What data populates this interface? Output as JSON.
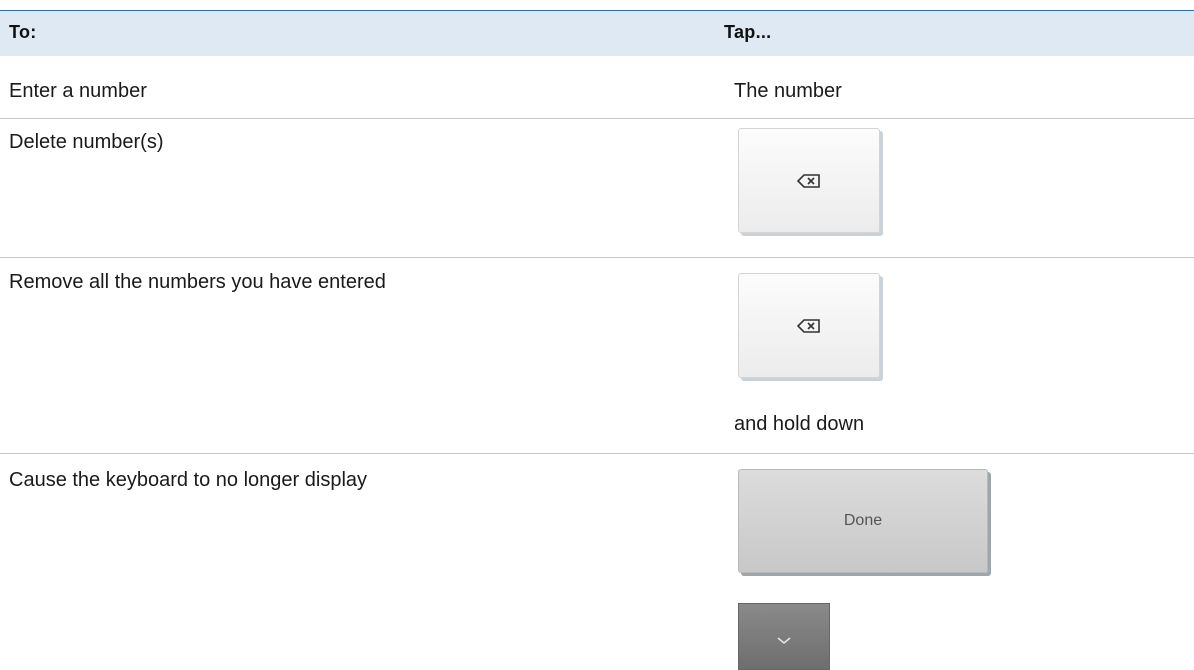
{
  "table": {
    "headers": {
      "col_action": "To:",
      "col_tap": "Tap..."
    },
    "rows": [
      {
        "action": "Enter a number",
        "tap": "The number"
      },
      {
        "action": "Delete number(s)",
        "key_icon": "backspace-icon"
      },
      {
        "action": "Remove all the numbers you have entered",
        "key_icon": "backspace-icon",
        "tap_suffix": "and hold down"
      },
      {
        "action": "Cause the keyboard to no longer display",
        "done_label": "Done",
        "key_icon_2": "chevron-down-icon"
      }
    ]
  },
  "colors": {
    "header_bg": "#dfe9f3",
    "top_rule": "#2c6e9b",
    "row_rule": "#c7c7c7"
  }
}
